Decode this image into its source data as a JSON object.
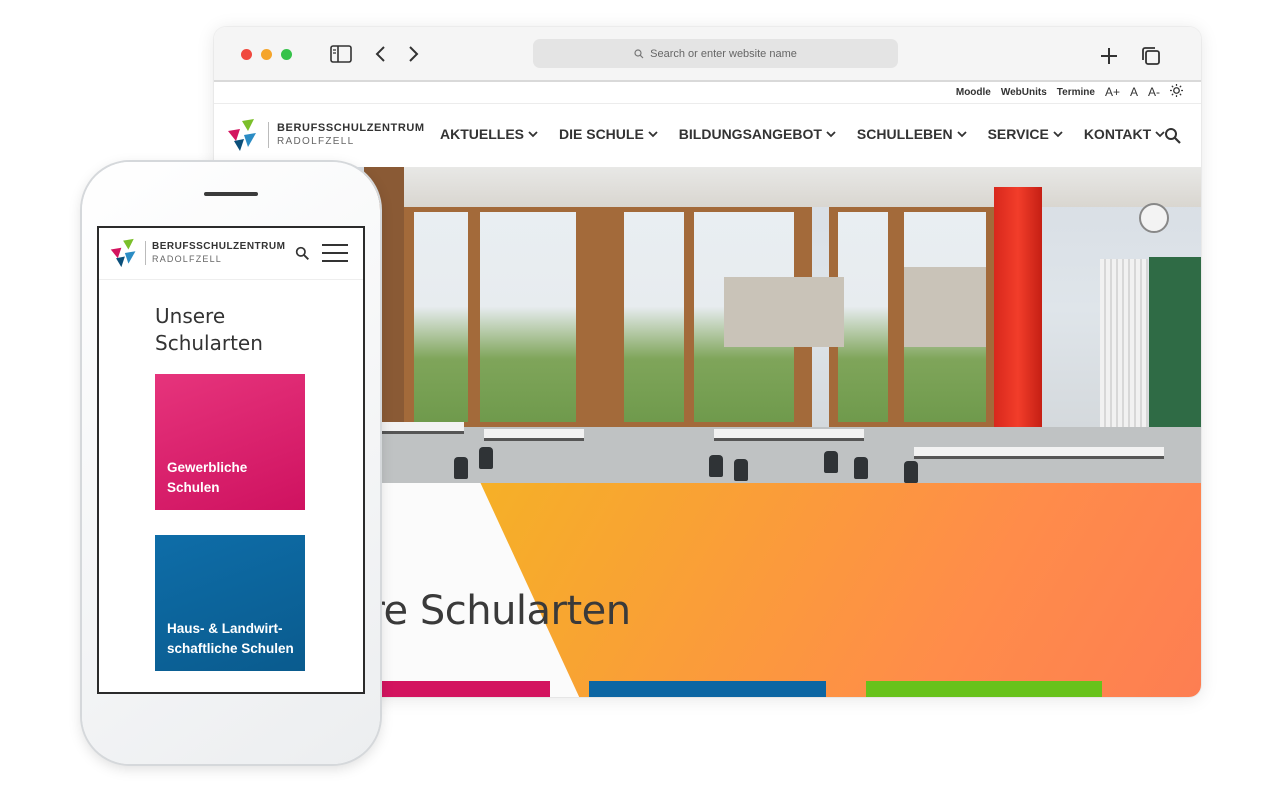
{
  "browser": {
    "address_placeholder": "Search or enter website name",
    "icons": {
      "sidebar": "sidebar-icon",
      "back": "chevron-left-icon",
      "forward": "chevron-right-icon",
      "new_tab": "plus-icon",
      "tabs": "tabs-icon",
      "address_search": "search-icon"
    }
  },
  "site": {
    "topbar": {
      "links": [
        "Moodle",
        "WebUnits",
        "Termine"
      ],
      "font_larger": "A+",
      "font_normal": "A",
      "font_smaller": "A-",
      "theme_icon": "sun-icon"
    },
    "logo": {
      "line1": "BERUFSSCHULZENTRUM",
      "line2": "RADOLFZELL"
    },
    "menu": [
      "AKTUELLES",
      "DIE SCHULE",
      "BILDUNGSANGEBOT",
      "SCHULLEBEN",
      "SERVICE",
      "KONTAKT"
    ],
    "section_heading": "sere Schularten"
  },
  "mobile": {
    "logo": {
      "line1": "BERUFSSCHULZENTRUM",
      "line2": "RADOLFZELL"
    },
    "title": "Unsere Schularten",
    "cards": [
      {
        "label_line1": "Gewerbliche",
        "label_line2": "Schulen",
        "color": "#d3145f"
      },
      {
        "label_line1": "Haus- & Landwirt-",
        "label_line2": "schaftliche Schulen",
        "color": "#0c66a3"
      }
    ]
  },
  "colors": {
    "magenta": "#d3145f",
    "blue": "#0c66a3",
    "green": "#67c21b",
    "orange": "#f8a531",
    "yellow": "#f2c119"
  }
}
